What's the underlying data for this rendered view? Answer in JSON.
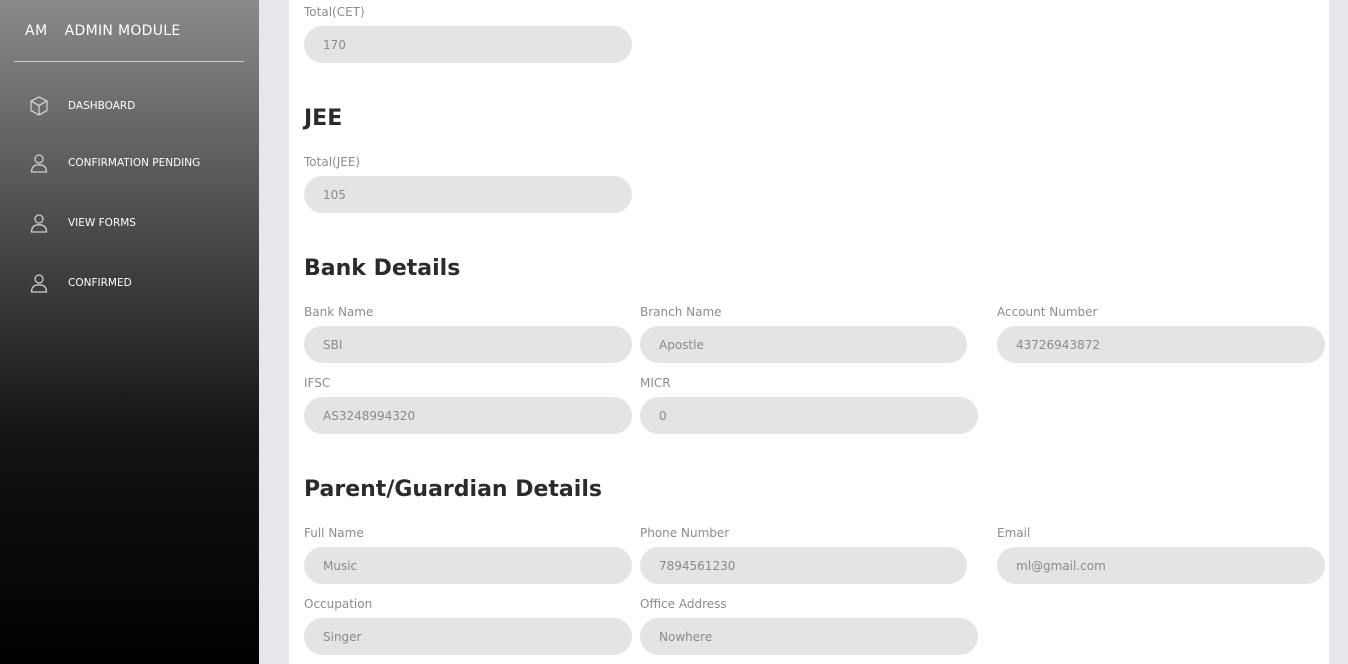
{
  "sidebar": {
    "brand_short": "AM",
    "brand_name": "ADMIN MODULE",
    "items": [
      {
        "label": "DASHBOARD",
        "icon": "cube-icon"
      },
      {
        "label": "CONFIRMATION PENDING",
        "icon": "user-icon"
      },
      {
        "label": "VIEW FORMS",
        "icon": "user-icon"
      },
      {
        "label": "CONFIRMED",
        "icon": "user-icon"
      }
    ]
  },
  "cet": {
    "total_label": "Total(CET)",
    "total_value": "170"
  },
  "jee": {
    "heading": "JEE",
    "total_label": "Total(JEE)",
    "total_value": "105"
  },
  "bank": {
    "heading": "Bank Details",
    "bank_name_label": "Bank Name",
    "bank_name": "SBI",
    "branch_label": "Branch Name",
    "branch": "Apostle",
    "account_label": "Account Number",
    "account": "43726943872",
    "ifsc_label": "IFSC",
    "ifsc": "AS3248994320",
    "micr_label": "MICR",
    "micr": "0"
  },
  "parent": {
    "heading": "Parent/Guardian Details",
    "name_label": "Full Name",
    "name": "Music",
    "phone_label": "Phone Number",
    "phone": "7894561230",
    "email_label": "Email",
    "email": "ml@gmail.com",
    "occupation_label": "Occupation",
    "occupation": "Singer",
    "office_label": "Office Address",
    "office": "Nowhere"
  },
  "colors": {
    "sidebar_top": "#8a8a8a",
    "sidebar_bottom": "#000000",
    "field_bg": "#e4e4e4",
    "page_bg": "#e6e7eb"
  }
}
